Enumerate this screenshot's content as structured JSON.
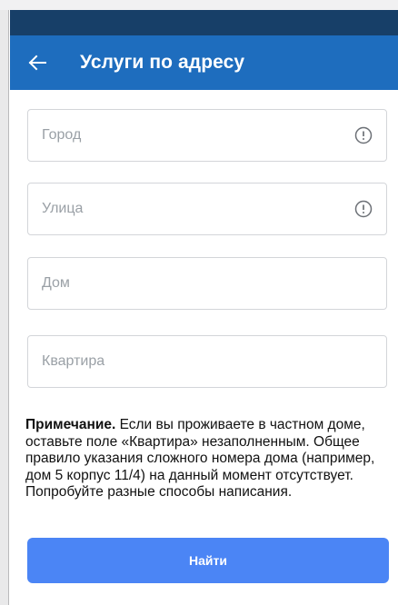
{
  "header": {
    "title": "Услуги по адресу",
    "back_icon": "arrow-left-icon"
  },
  "form": {
    "city_placeholder": "Город",
    "street_placeholder": "Улица",
    "house_placeholder": "Дом",
    "apartment_placeholder": "Квартира"
  },
  "note": {
    "label": "Примечание.",
    "text": " Если вы проживаете в частном доме, оставьте поле «Квартира» незаполненным. Общее правило указания сложного номера дома (например, дом 5 корпус 11/4) на данный момент отсутствует. Попробуйте разные способы написания."
  },
  "actions": {
    "find_label": "Найти"
  },
  "colors": {
    "status_bar": "#173f68",
    "app_bar": "#1e6dbe",
    "button": "#4b85f5",
    "field_border": "#d3d5d9"
  }
}
